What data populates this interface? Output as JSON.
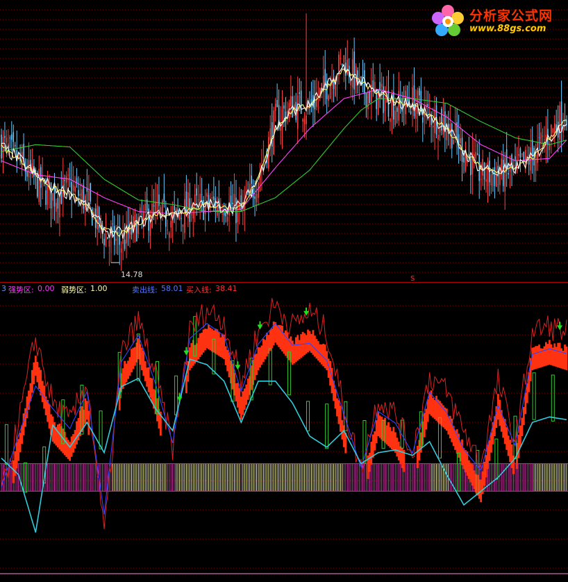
{
  "logo": {
    "title": "分析家公式网",
    "url": "www.88gs.com"
  },
  "price_panel": {
    "low_marker": "14.78",
    "signal_mark": "S"
  },
  "indicator_legend": {
    "panel_index": "3",
    "strong_zone": {
      "label": "强势区:",
      "value": "0.00",
      "color": "#ff33ff"
    },
    "weak_zone": {
      "label": "弱势区:",
      "value": "1.00",
      "color": "#ffffaa"
    },
    "sell_line": {
      "label": "卖出线:",
      "value": "58.01",
      "color": "#5555ff"
    },
    "buy_line": {
      "label": "买入线:",
      "value": "38.41",
      "color": "#ff3333"
    }
  },
  "colors": {
    "up_candle": "#ff4444",
    "down_candle": "#66ccff",
    "ma_short": "#ffffff",
    "ma_mid": "#ffff66",
    "ma_medium": "#ff44ff",
    "ma_long": "#33cc33",
    "grid": "#8b0000",
    "divider": "#b00000",
    "sell_line": "#3344ff",
    "buy_line": "#33ccdd",
    "raw_line": "#dd2222",
    "bar_fill": "#ff3311",
    "box_stroke": "#33cc33",
    "strong_band": "#cc33aa",
    "weak_band": "#eeee99",
    "arrow": "#22dd22"
  },
  "chart_data": [
    {
      "type": "candlestick",
      "title": "",
      "ylim": [
        14.0,
        26.0
      ],
      "annotations": [
        "14.78",
        "S"
      ],
      "series_anchors": {
        "close": [
          [
            0,
            20.0
          ],
          [
            10,
            19.2
          ],
          [
            20,
            18.3
          ],
          [
            30,
            17.6
          ],
          [
            40,
            18.1
          ],
          [
            50,
            17.4
          ],
          [
            60,
            16.0
          ],
          [
            70,
            15.6
          ],
          [
            80,
            16.5
          ],
          [
            90,
            17.0
          ],
          [
            100,
            16.6
          ],
          [
            110,
            17.2
          ],
          [
            120,
            17.3
          ],
          [
            130,
            17.4
          ],
          [
            140,
            16.9
          ],
          [
            150,
            18.5
          ],
          [
            160,
            21.0
          ],
          [
            170,
            21.6
          ],
          [
            180,
            21.5
          ],
          [
            190,
            22.5
          ],
          [
            200,
            23.6
          ],
          [
            210,
            22.3
          ],
          [
            220,
            22.0
          ],
          [
            230,
            21.6
          ],
          [
            240,
            21.8
          ],
          [
            250,
            21.2
          ],
          [
            260,
            20.8
          ],
          [
            270,
            19.6
          ],
          [
            280,
            18.6
          ],
          [
            290,
            18.6
          ],
          [
            300,
            18.8
          ],
          [
            310,
            19.4
          ],
          [
            320,
            20.4
          ],
          [
            330,
            21.4
          ]
        ],
        "ma_short": [
          [
            0,
            19.8
          ],
          [
            10,
            19.3
          ],
          [
            20,
            18.6
          ],
          [
            30,
            18.0
          ],
          [
            40,
            17.8
          ],
          [
            50,
            17.2
          ],
          [
            60,
            16.2
          ],
          [
            70,
            16.0
          ],
          [
            80,
            16.5
          ],
          [
            90,
            16.9
          ],
          [
            100,
            16.9
          ],
          [
            110,
            17.1
          ],
          [
            120,
            17.3
          ],
          [
            130,
            17.2
          ],
          [
            140,
            17.2
          ],
          [
            150,
            18.4
          ],
          [
            160,
            20.6
          ],
          [
            170,
            21.4
          ],
          [
            180,
            21.6
          ],
          [
            190,
            22.4
          ],
          [
            200,
            23.2
          ],
          [
            210,
            22.6
          ],
          [
            220,
            22.1
          ],
          [
            230,
            21.8
          ],
          [
            240,
            21.6
          ],
          [
            250,
            21.2
          ],
          [
            260,
            20.6
          ],
          [
            270,
            19.6
          ],
          [
            280,
            18.9
          ],
          [
            290,
            18.7
          ],
          [
            300,
            18.9
          ],
          [
            310,
            19.3
          ],
          [
            320,
            20.2
          ],
          [
            330,
            21.0
          ]
        ],
        "ma_medium": [
          [
            0,
            19.2
          ],
          [
            20,
            18.6
          ],
          [
            40,
            18.4
          ],
          [
            60,
            17.6
          ],
          [
            80,
            17.0
          ],
          [
            100,
            16.9
          ],
          [
            120,
            17.0
          ],
          [
            140,
            17.1
          ],
          [
            160,
            18.9
          ],
          [
            180,
            20.6
          ],
          [
            200,
            21.9
          ],
          [
            220,
            22.3
          ],
          [
            240,
            21.9
          ],
          [
            260,
            21.1
          ],
          [
            280,
            19.9
          ],
          [
            300,
            19.2
          ],
          [
            320,
            19.3
          ],
          [
            330,
            20.1
          ]
        ],
        "ma_long": [
          [
            0,
            19.6
          ],
          [
            20,
            19.9
          ],
          [
            40,
            19.8
          ],
          [
            60,
            18.4
          ],
          [
            80,
            17.5
          ],
          [
            100,
            17.3
          ],
          [
            120,
            17.0
          ],
          [
            140,
            17.0
          ],
          [
            160,
            17.6
          ],
          [
            180,
            18.8
          ],
          [
            200,
            20.6
          ],
          [
            210,
            21.4
          ],
          [
            220,
            21.9
          ],
          [
            240,
            21.9
          ],
          [
            260,
            21.7
          ],
          [
            280,
            20.9
          ],
          [
            300,
            20.2
          ],
          [
            320,
            19.9
          ],
          [
            330,
            20.1
          ]
        ]
      }
    },
    {
      "type": "line",
      "title": "",
      "ylim": [
        0,
        100
      ],
      "series": [
        {
          "name": "卖出线",
          "values": [
            58.01
          ]
        },
        {
          "name": "买入线",
          "values": [
            38.41
          ]
        },
        {
          "name": "强势区",
          "values": [
            0.0
          ]
        },
        {
          "name": "弱势区",
          "values": [
            1.0
          ]
        }
      ],
      "series_anchors": {
        "raw": [
          [
            0,
            28
          ],
          [
            10,
            55
          ],
          [
            20,
            86
          ],
          [
            30,
            62
          ],
          [
            40,
            55
          ],
          [
            50,
            70
          ],
          [
            60,
            14
          ],
          [
            70,
            80
          ],
          [
            80,
            92
          ],
          [
            90,
            72
          ],
          [
            100,
            46
          ],
          [
            110,
            88
          ],
          [
            120,
            96
          ],
          [
            130,
            92
          ],
          [
            140,
            70
          ],
          [
            150,
            88
          ],
          [
            160,
            98
          ],
          [
            170,
            90
          ],
          [
            180,
            95
          ],
          [
            190,
            88
          ],
          [
            200,
            60
          ],
          [
            210,
            38
          ],
          [
            220,
            64
          ],
          [
            230,
            58
          ],
          [
            240,
            44
          ],
          [
            250,
            72
          ],
          [
            260,
            66
          ],
          [
            270,
            52
          ],
          [
            280,
            40
          ],
          [
            290,
            70
          ],
          [
            300,
            48
          ],
          [
            310,
            88
          ],
          [
            320,
            90
          ],
          [
            330,
            88
          ]
        ],
        "buy": [
          [
            0,
            42
          ],
          [
            10,
            36
          ],
          [
            20,
            15
          ],
          [
            30,
            54
          ],
          [
            40,
            46
          ],
          [
            50,
            55
          ],
          [
            60,
            44
          ],
          [
            70,
            68
          ],
          [
            80,
            71
          ],
          [
            90,
            60
          ],
          [
            100,
            52
          ],
          [
            110,
            78
          ],
          [
            120,
            76
          ],
          [
            130,
            70
          ],
          [
            140,
            55
          ],
          [
            150,
            70
          ],
          [
            160,
            70
          ],
          [
            170,
            62
          ],
          [
            180,
            50
          ],
          [
            190,
            46
          ],
          [
            200,
            52
          ],
          [
            210,
            40
          ],
          [
            220,
            44
          ],
          [
            230,
            45
          ],
          [
            240,
            43
          ],
          [
            250,
            48
          ],
          [
            260,
            36
          ],
          [
            270,
            25
          ],
          [
            280,
            30
          ],
          [
            290,
            35
          ],
          [
            300,
            42
          ],
          [
            310,
            55
          ],
          [
            320,
            57
          ],
          [
            330,
            56
          ]
        ]
      }
    }
  ]
}
